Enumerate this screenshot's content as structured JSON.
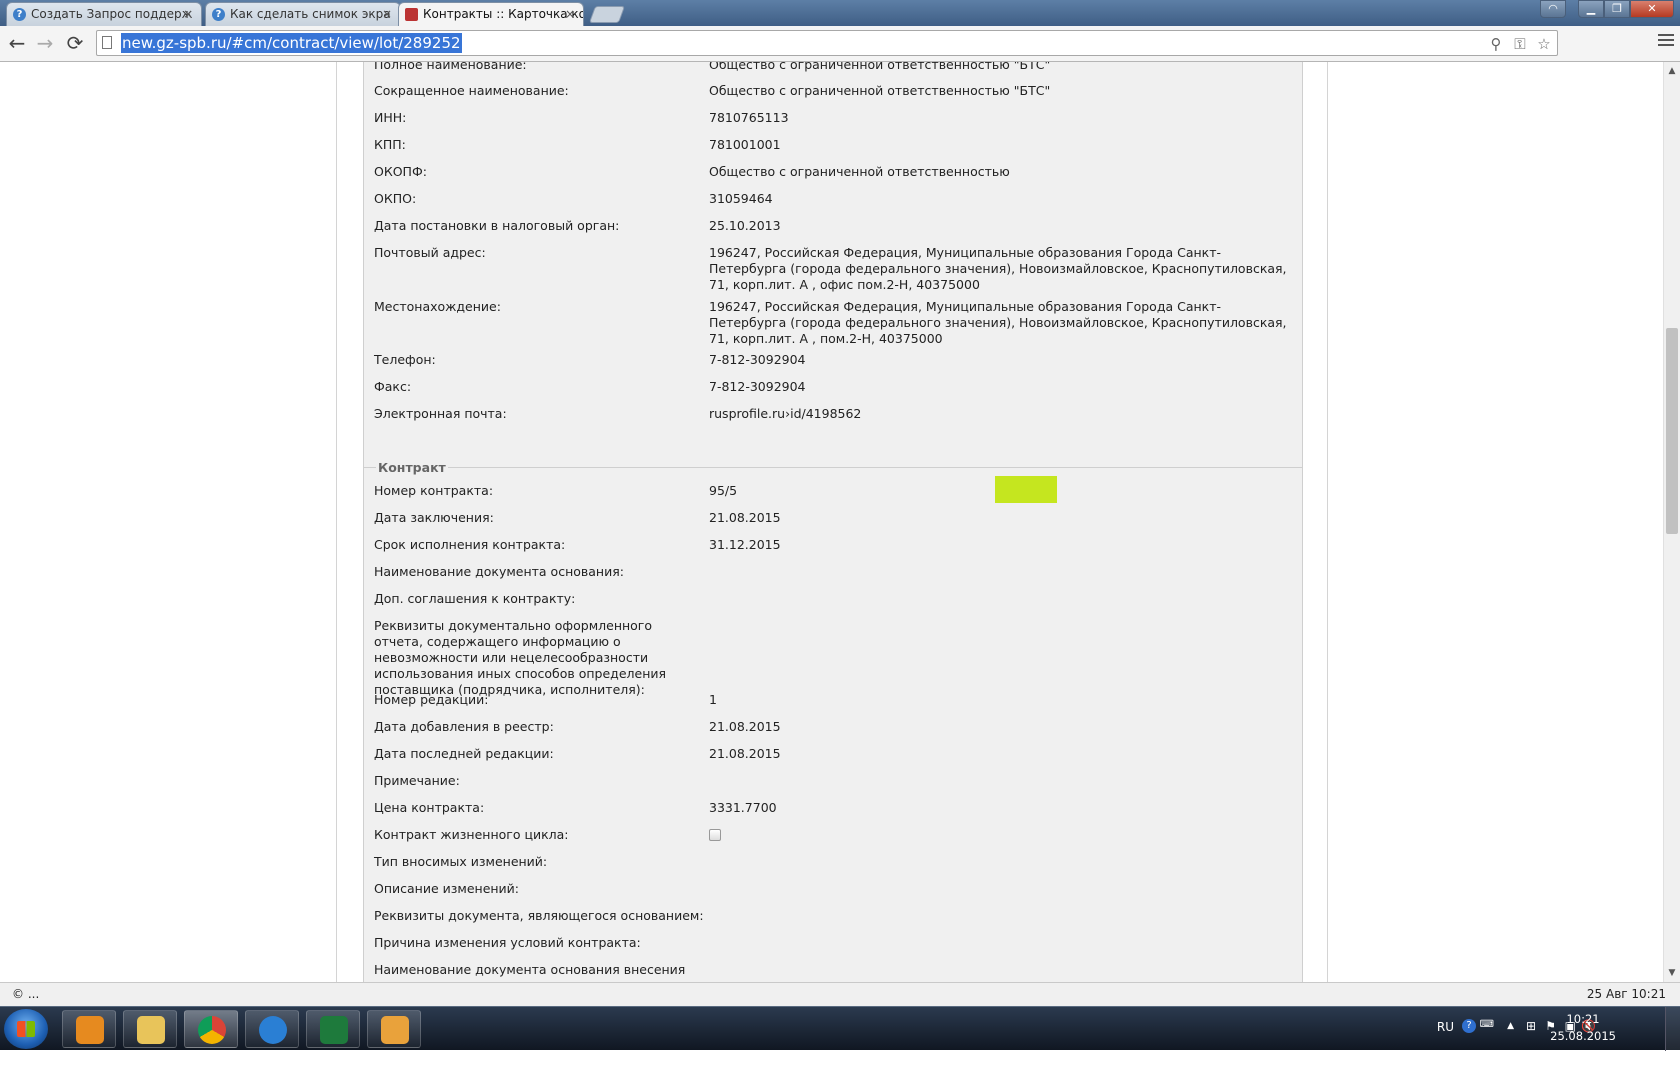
{
  "browser": {
    "tabs": [
      {
        "label": "Создать Запрос поддерж",
        "icon": "help-icon",
        "close": "×"
      },
      {
        "label": "Как сделать снимок экра",
        "icon": "help-icon",
        "close": "×"
      },
      {
        "label": "Контракты :: Карточка ко",
        "icon": "hammer-icon",
        "close": "×"
      }
    ],
    "url": "new.gz-spb.ru/#cm/contract/view/lot/289252",
    "nav": {
      "back": "←",
      "forward": "→",
      "reload": "⟳"
    },
    "omnibox_icons": {
      "zoom": "⚲",
      "key": "⚿",
      "star": "☆"
    }
  },
  "organization": {
    "fields": [
      {
        "label": "Полное наименование:",
        "value": "Общество с ограниченной ответственностью \"БТС\""
      },
      {
        "label": "Сокращенное наименование:",
        "value": "Общество с ограниченной ответственностью \"БТС\""
      },
      {
        "label": "ИНН:",
        "value": "7810765113"
      },
      {
        "label": "КПП:",
        "value": "781001001"
      },
      {
        "label": "ОКОПФ:",
        "value": "Общество с ограниченной ответственностью"
      },
      {
        "label": "ОКПО:",
        "value": "31059464"
      },
      {
        "label": "Дата постановки в налоговый орган:",
        "value": "25.10.2013"
      },
      {
        "label": "Почтовый адрес:",
        "value": "196247, Российская Федерация, Муниципальные образования Города Санкт-Петербурга (города федерального значения), Новоизмайловское, Краснопутиловская, 71, корп.лит. А , офис пом.2-Н, 40375000"
      },
      {
        "label": "Местонахождение:",
        "value": "196247, Российская Федерация, Муниципальные образования Города Санкт-Петербурга (города федерального значения), Новоизмайловское, Краснопутиловская, 71, корп.лит. А , пом.2-Н, 40375000"
      },
      {
        "label": "Телефон:",
        "value": "7-812-3092904"
      },
      {
        "label": "Факс:",
        "value": "7-812-3092904"
      },
      {
        "label": "Электронная почта:",
        "value": "rusprofile.ru›id/4198562"
      }
    ]
  },
  "contract": {
    "title": "Контракт",
    "fields": [
      {
        "label": "Номер контракта:",
        "value": "95/5"
      },
      {
        "label": "Дата заключения:",
        "value": "21.08.2015"
      },
      {
        "label": "Срок исполнения контракта:",
        "value": "31.12.2015"
      },
      {
        "label": "Наименование документа основания:",
        "value": ""
      },
      {
        "label": "Доп. соглашения к контракту:",
        "value": ""
      },
      {
        "label": "Реквизиты документально оформленного отчета, содержащего информацию о невозможности или нецелесообразности использования иных способов определения поставщика (подрядчика, исполнителя):",
        "value": ""
      },
      {
        "label": "Номер редакции:",
        "value": "1"
      },
      {
        "label": "Дата добавления в реестр:",
        "value": "21.08.2015"
      },
      {
        "label": "Дата последней редакции:",
        "value": "21.08.2015"
      },
      {
        "label": "Примечание:",
        "value": ""
      },
      {
        "label": "Цена контракта:",
        "value": "3331.7700"
      },
      {
        "label": "Контракт жизненного цикла:",
        "value": "",
        "checked": false
      },
      {
        "label": "Тип вносимых изменений:",
        "value": ""
      },
      {
        "label": "Описание изменений:",
        "value": ""
      },
      {
        "label": "Реквизиты документа, являющегося основанием:",
        "value": ""
      },
      {
        "label": "Причина изменения условий контракта:",
        "value": ""
      },
      {
        "label": "Наименование документа основания внесения",
        "value": ""
      }
    ],
    "highlight_color": "#c5e61f"
  },
  "statusbar": {
    "left": "© ...",
    "right": "25 Авг 10:21"
  },
  "taskbar": {
    "apps": [
      "media-player-icon",
      "file-explorer-icon",
      "chrome-icon",
      "internet-explorer-icon",
      "excel-icon",
      "outlook-icon"
    ],
    "lang": "RU",
    "time": "10:21",
    "date": "25.08.2015"
  }
}
